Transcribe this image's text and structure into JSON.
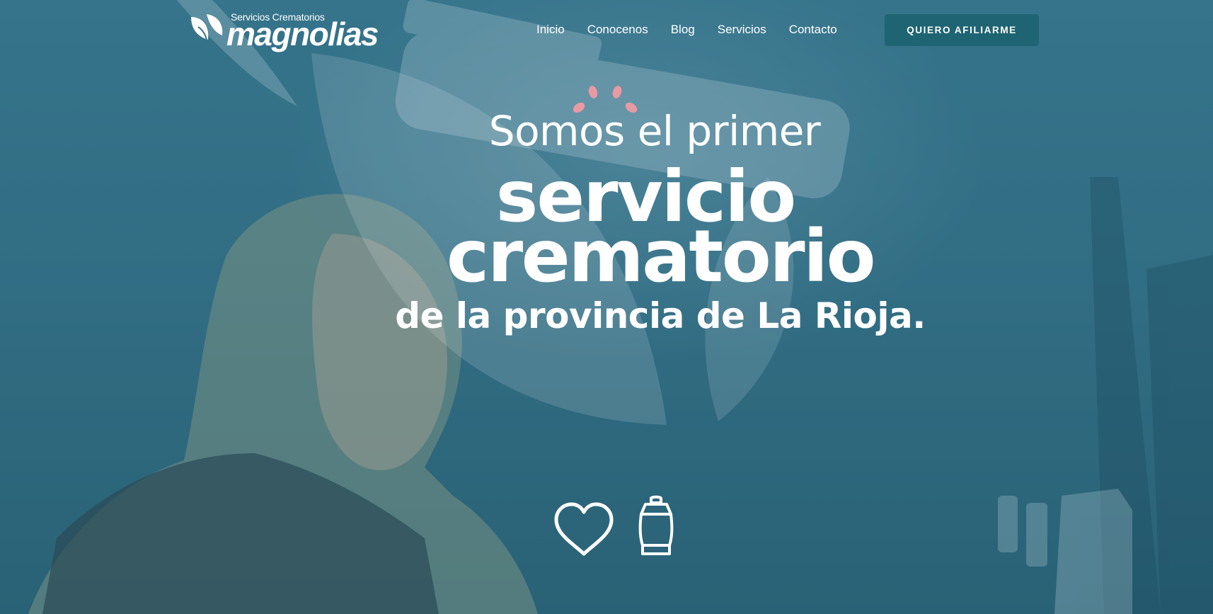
{
  "header": {
    "logo": {
      "small_text": "Servicios Crematorios",
      "brand": "magnolias",
      "icon": "magnolia-leaf-logo-icon"
    },
    "nav": [
      {
        "label": "Inicio"
      },
      {
        "label": "Conocenos"
      },
      {
        "label": "Blog"
      },
      {
        "label": "Servicios"
      },
      {
        "label": "Contacto"
      }
    ],
    "cta_label": "QUIERO AFILIARME"
  },
  "hero": {
    "line1": "Somos el primer",
    "line2": "servicio",
    "line3": "crematorio",
    "line4": "de la provincia de La Rioja.",
    "icons": [
      "heart-icon",
      "urn-icon"
    ],
    "petals_icon": "flower-petals-icon"
  },
  "colors": {
    "overlay_teal": "#2f6a80",
    "cta_background": "#1f6472",
    "petal_pink": "#e79aa3",
    "text": "#ffffff"
  }
}
